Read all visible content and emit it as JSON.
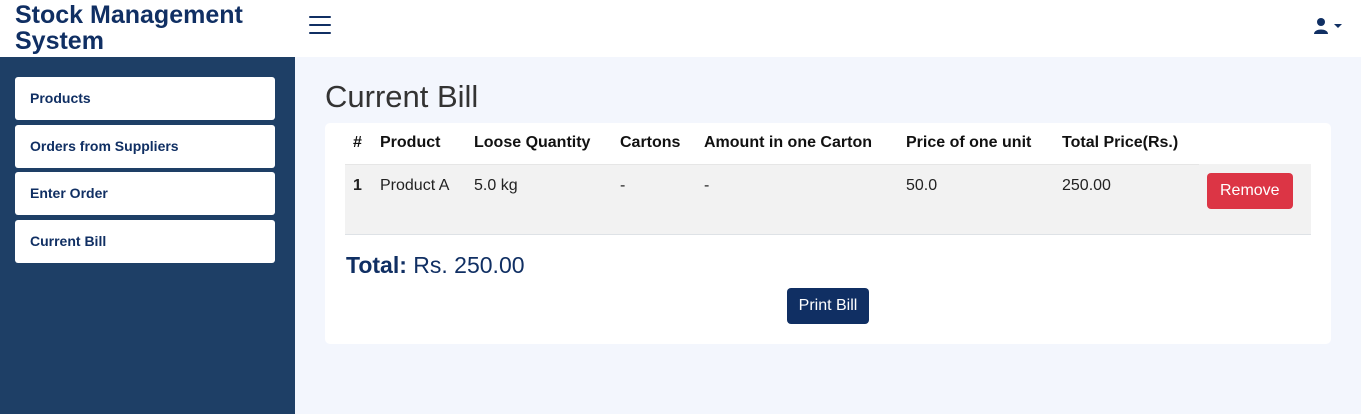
{
  "app": {
    "title": "Stock Management System"
  },
  "header": {
    "menu_icon": "hamburger-icon",
    "user_icon": "user-icon",
    "caret_icon": "caret-down-icon"
  },
  "sidebar": {
    "items": [
      {
        "label": "Products"
      },
      {
        "label": "Orders from Suppliers"
      },
      {
        "label": "Enter Order"
      },
      {
        "label": "Current Bill"
      }
    ]
  },
  "page": {
    "title": "Current Bill"
  },
  "bill": {
    "columns": [
      "#",
      "Product",
      "Loose Quantity",
      "Cartons",
      "Amount in one Carton",
      "Price of one unit",
      "Total Price(Rs.)"
    ],
    "rows": [
      {
        "num": "1",
        "product": "Product A",
        "loose_quantity": "5.0 kg",
        "cartons": "-",
        "amount_in_carton": "-",
        "unit_price": "50.0",
        "total_price": "250.00",
        "remove_label": "Remove"
      }
    ],
    "total_label": "Total:",
    "total_value": "Rs. 250.00",
    "print_label": "Print Bill"
  },
  "colors": {
    "brand": "#102f63",
    "sidebar_bg": "#1e3f66",
    "danger": "#dc3545",
    "page_bg": "#f3f6fd"
  }
}
